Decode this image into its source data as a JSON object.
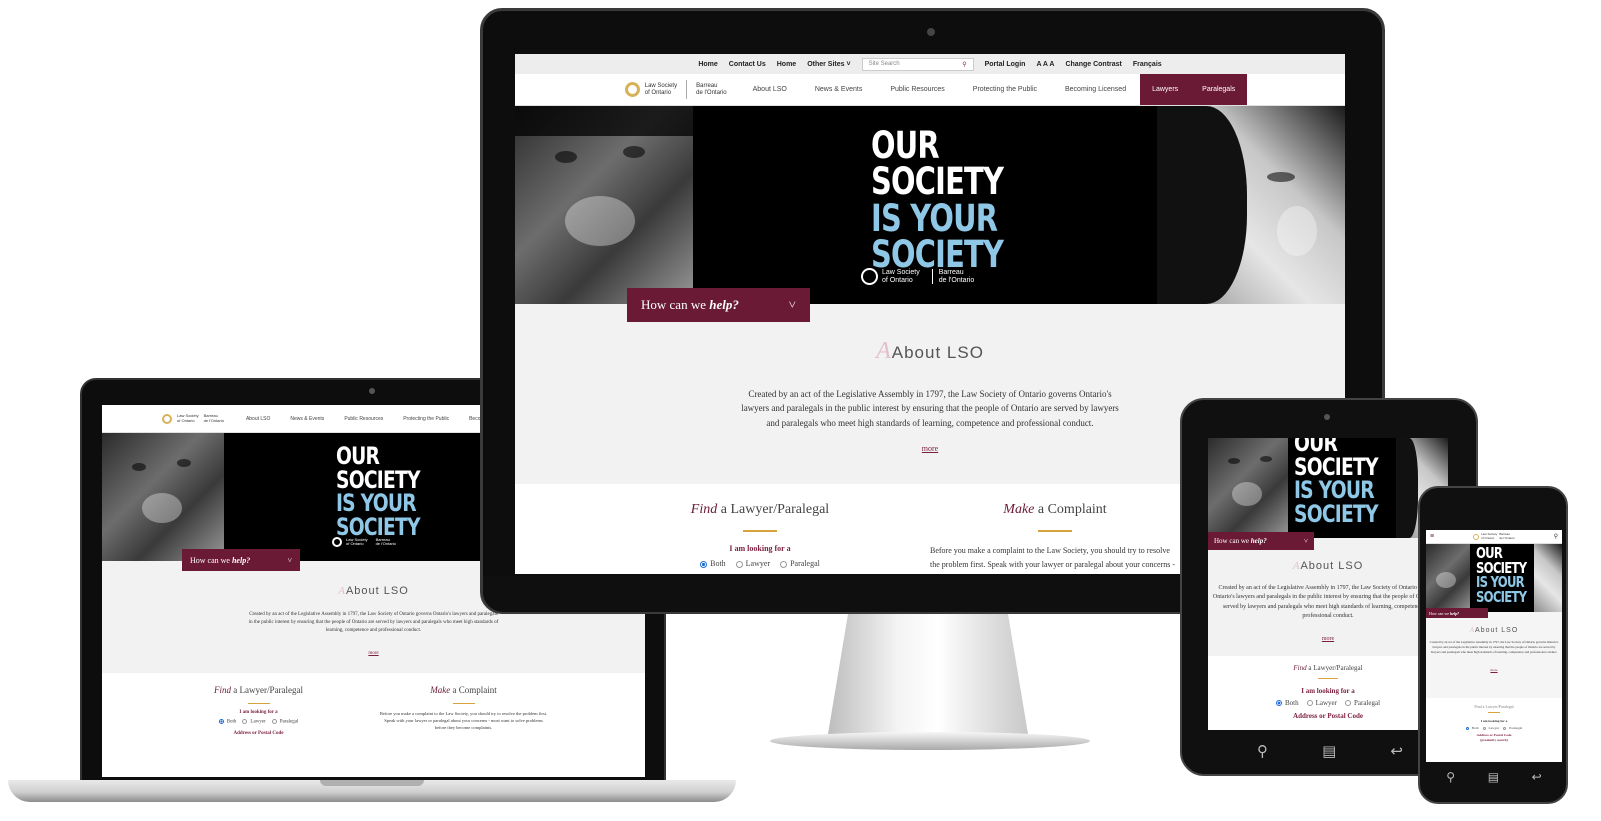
{
  "site": {
    "utility": {
      "home": "Home",
      "contact": "Contact Us",
      "home2": "Home",
      "other_sites": "Other Sites",
      "search_placeholder": "Site Search",
      "portal_login": "Portal Login",
      "text_size": "A A A",
      "change_contrast": "Change Contrast",
      "language": "Français"
    },
    "logo": {
      "en_line1": "Law Society",
      "en_line2": "of Ontario",
      "fr_line1": "Barreau",
      "fr_line2": "de l'Ontario"
    },
    "nav": [
      {
        "label": "About LSO"
      },
      {
        "label": "News & Events"
      },
      {
        "label": "Public Resources"
      },
      {
        "label": "Protecting the Public"
      },
      {
        "label": "Becoming Licensed"
      },
      {
        "label": "Lawyers"
      },
      {
        "label": "Paralegals"
      }
    ],
    "hero": {
      "line1": "OUR",
      "line2": "SOCIETY",
      "line3": "IS YOUR",
      "line4": "SOCIETY"
    },
    "help": {
      "prefix": "How can we",
      "emphasis": "help?",
      "chevron": "˅"
    },
    "about": {
      "accent": "A",
      "title": "About LSO",
      "body": "Created by an act of the Legislative Assembly in 1797, the Law Society of Ontario governs Ontario's lawyers and paralegals in the public interest by ensuring that the people of Ontario are served by lawyers and paralegals who meet high standards of learning, competence and professional conduct.",
      "more": "more"
    },
    "find": {
      "emphasis": "Find",
      "rest": "a Lawyer/Paralegal",
      "looking": "I am looking for a",
      "options": [
        "Both",
        "Lawyer",
        "Paralegal"
      ],
      "address_label": "Address or Postal Code"
    },
    "complaint": {
      "emphasis": "Make",
      "rest": "a Complaint",
      "body": "Before you make a complaint to the Law Society, you should try to resolve the problem first. Speak with your lawyer or paralegal about your concerns - most want to solve problems before they become complaints."
    },
    "phone": {
      "find_short": "Find a Lawyer/Paralegal",
      "looking": "I am looking for a",
      "address_label": "Address or Postal Code",
      "proximity": "(proximity search)"
    }
  },
  "colors": {
    "maroon": "#6b1a35",
    "hero_blue": "#8fc8e6",
    "gold": "#d8a23a"
  },
  "icons": {
    "search": "search-icon",
    "back": "back-icon",
    "home": "home-icon",
    "menu": "menu-icon"
  }
}
